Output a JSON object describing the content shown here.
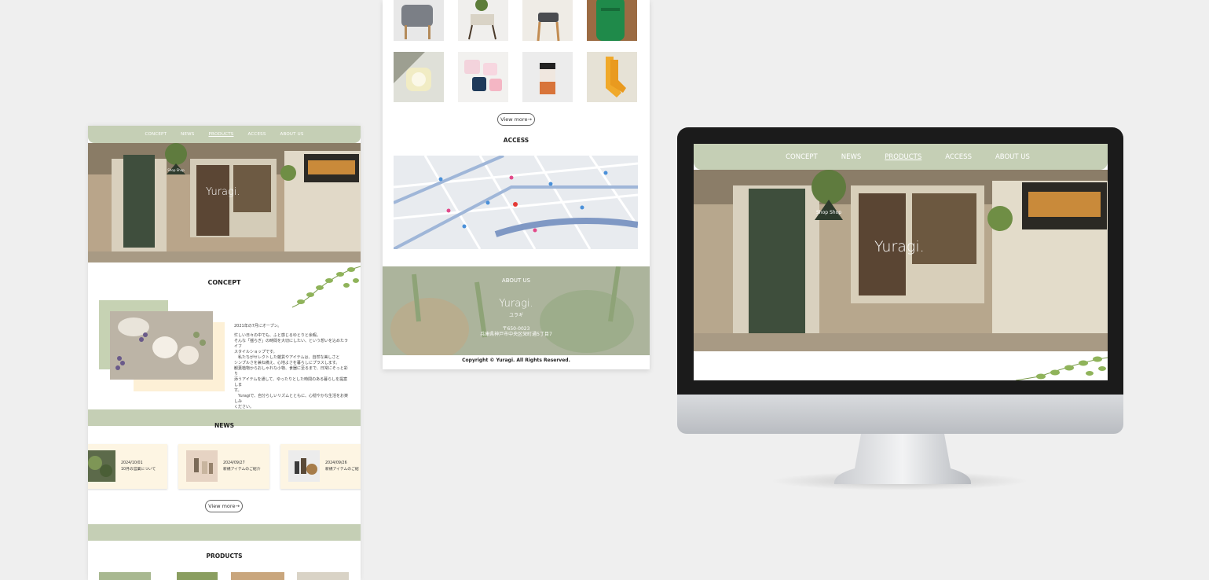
{
  "nav": {
    "items": [
      "CONCEPT",
      "NEWS",
      "PRODUCTS",
      "ACCESS",
      "ABOUT US"
    ],
    "active": "PRODUCTS"
  },
  "brand": {
    "logo": "Yuragi.",
    "kana": "ユラギ",
    "shop_sign": "Shop Shop"
  },
  "concept": {
    "title": "CONCEPT",
    "lines": [
      "2021年の7月にオープン。",
      "",
      "忙しい日々の中でも、ふと感じるゆとりと余暇。",
      "そんな「揺らぎ」の時間を大切にしたい、という想いを込めたライフ",
      "スタイルショップです。",
      "　私たちがセレクトした雑貨やアイテムは、自然な美しさと",
      "シンプルさを兼ね備え、心地よさを暮らしにプラスします。",
      "観葉植物からおしゃれな小物、食器に至るまで、日常にそっと彩り",
      "添うアイテムを通して、ゆったりとした時間のある暮らしを提案しま",
      "す。",
      "　Yuragiで、自分らしいリズムとともに、心穏やかな生活をお楽しみ",
      "ください。"
    ]
  },
  "news": {
    "title": "NEWS",
    "items": [
      {
        "date": "2024/10/01",
        "title": "10月の営業について"
      },
      {
        "date": "2024/09/27",
        "title": "新規アイテムのご紹介"
      },
      {
        "date": "2024/09/26",
        "title": "新規アイテムのご紹"
      }
    ],
    "view_more": "View more→"
  },
  "products": {
    "title": "PRODUCTS",
    "view_more": "View more→"
  },
  "access": {
    "title": "ACCESS"
  },
  "about": {
    "title": "ABOUT US",
    "postal": "〒650-0023",
    "address": "兵庫県神戸市中央区栄町通5丁目7"
  },
  "footer": {
    "copyright": "Copyright © Yuragi. All Rights Reserved."
  },
  "colors": {
    "sage": "#c5cfb5",
    "cream": "#fdf5e3",
    "background": "#efefef"
  }
}
